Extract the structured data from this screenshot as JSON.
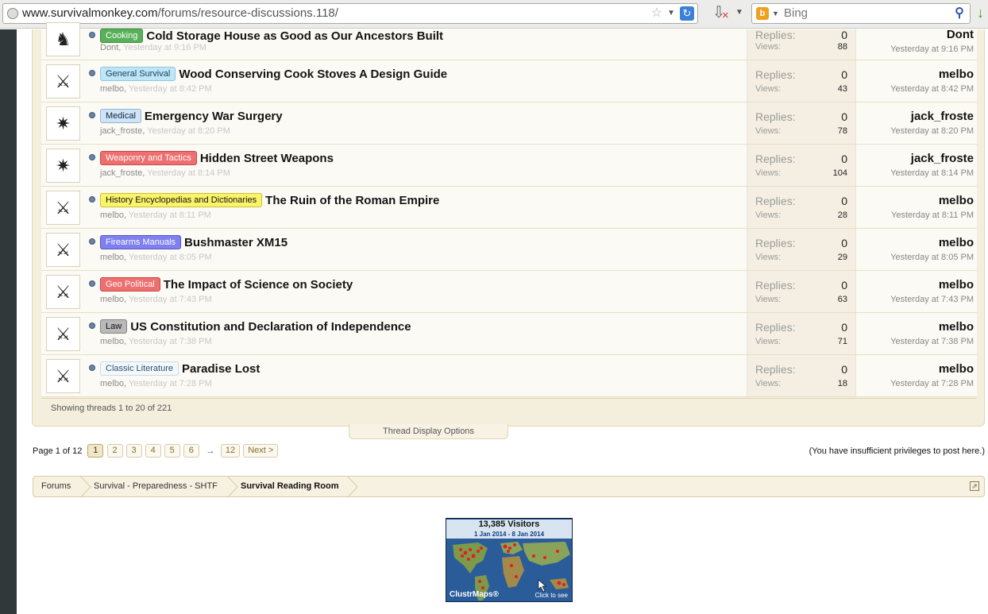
{
  "browser": {
    "url_host": "www.survivalmonkey.com",
    "url_path": "/forums/resource-discussions.118/",
    "search_placeholder": "Bing"
  },
  "threads": [
    {
      "prefix": "Cooking",
      "prefix_style": "p-green",
      "title": "Cold Storage House as Good as Our Ancestors Built",
      "author": "Dont",
      "when": "Yesterday at 9:16 PM",
      "replies": "0",
      "views": "88",
      "last_poster": "Dont",
      "last_time": "Yesterday at 9:16 PM",
      "avatar": "rider"
    },
    {
      "prefix": "General Survival",
      "prefix_style": "p-lightblue",
      "title": "Wood Conserving Cook Stoves A Design Guide",
      "author": "melbo",
      "when": "Yesterday at 8:42 PM",
      "replies": "0",
      "views": "43",
      "last_poster": "melbo",
      "last_time": "Yesterday at 8:42 PM",
      "avatar": "hunter"
    },
    {
      "prefix": "Medical",
      "prefix_style": "p-blue",
      "title": "Emergency War Surgery",
      "author": "jack_froste",
      "when": "Yesterday at 8:20 PM",
      "replies": "0",
      "views": "78",
      "last_poster": "jack_froste",
      "last_time": "Yesterday at 8:20 PM",
      "avatar": "rune"
    },
    {
      "prefix": "Weaponry and Tactics",
      "prefix_style": "p-red",
      "title": "Hidden Street Weapons",
      "author": "jack_froste",
      "when": "Yesterday at 8:14 PM",
      "replies": "0",
      "views": "104",
      "last_poster": "jack_froste",
      "last_time": "Yesterday at 8:14 PM",
      "avatar": "rune"
    },
    {
      "prefix": "History Encyclopedias and Dictionaries",
      "prefix_style": "p-yellow",
      "title": "The Ruin of the Roman Empire",
      "author": "melbo",
      "when": "Yesterday at 8:11 PM",
      "replies": "0",
      "views": "28",
      "last_poster": "melbo",
      "last_time": "Yesterday at 8:11 PM",
      "avatar": "hunter"
    },
    {
      "prefix": "Firearms Manuals",
      "prefix_style": "p-purple",
      "title": "Bushmaster XM15",
      "author": "melbo",
      "when": "Yesterday at 8:05 PM",
      "replies": "0",
      "views": "29",
      "last_poster": "melbo",
      "last_time": "Yesterday at 8:05 PM",
      "avatar": "hunter"
    },
    {
      "prefix": "Geo Political",
      "prefix_style": "p-red",
      "title": "The Impact of Science on Society",
      "author": "melbo",
      "when": "Yesterday at 7:43 PM",
      "replies": "0",
      "views": "63",
      "last_poster": "melbo",
      "last_time": "Yesterday at 7:43 PM",
      "avatar": "hunter"
    },
    {
      "prefix": "Law",
      "prefix_style": "p-grey",
      "title": "US Constitution and Declaration of Independence",
      "author": "melbo",
      "when": "Yesterday at 7:38 PM",
      "replies": "0",
      "views": "71",
      "last_poster": "melbo",
      "last_time": "Yesterday at 7:38 PM",
      "avatar": "hunter"
    },
    {
      "prefix": "Classic Literature",
      "prefix_style": "p-white",
      "title": "Paradise Lost",
      "author": "melbo",
      "when": "Yesterday at 7:28 PM",
      "replies": "0",
      "views": "18",
      "last_poster": "melbo",
      "last_time": "Yesterday at 7:28 PM",
      "avatar": "hunter"
    }
  ],
  "labels": {
    "replies": "Replies:",
    "views": "Views:"
  },
  "showing": "Showing threads 1 to 20 of 221",
  "display_options": "Thread Display Options",
  "pagination": {
    "label": "Page 1 of 12",
    "pages": [
      "1",
      "2",
      "3",
      "4",
      "5",
      "6"
    ],
    "arrow": "→",
    "last": "12",
    "next": "Next >"
  },
  "privileges": "(You have insufficient privileges to post here.)",
  "breadcrumb": [
    "Forums",
    "Survival - Preparedness - SHTF",
    "Survival Reading Room"
  ],
  "clustr": {
    "visitors": "13,385  Visitors",
    "range": "1 Jan 2014 - 8 Jan 2014",
    "brand": "ClustrMaps®",
    "cta": "Click to see"
  },
  "colors": {
    "panel": "#f4eedc",
    "strip": "#313839"
  }
}
